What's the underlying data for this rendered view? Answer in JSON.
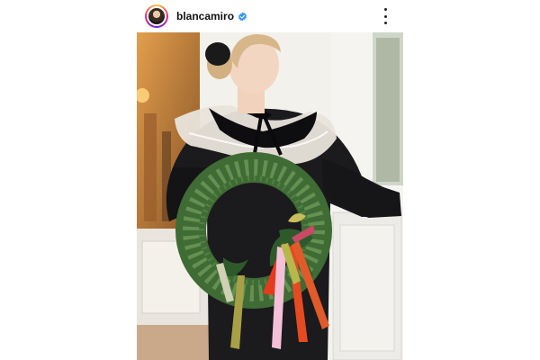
{
  "post": {
    "username": "blancamiro",
    "verified": true,
    "icons": {
      "avatar": "profile-avatar",
      "verified": "verified-badge-icon",
      "more": "more-options-icon"
    },
    "colors": {
      "verified_badge": "#3897f0",
      "story_ring": [
        "#f9ce34",
        "#ee2a7b",
        "#6228d7"
      ]
    }
  }
}
